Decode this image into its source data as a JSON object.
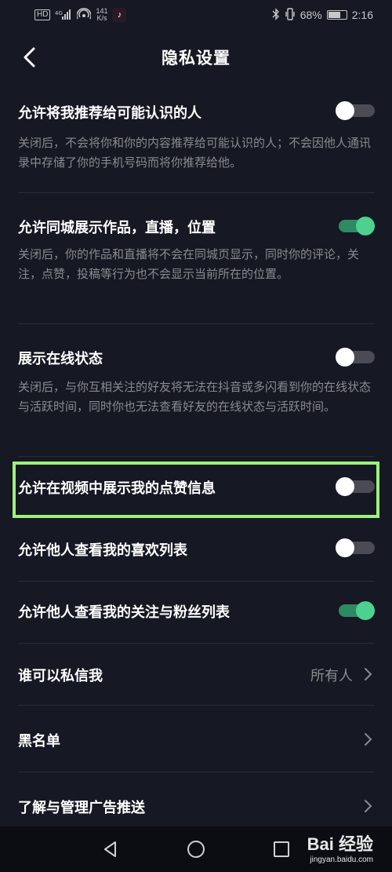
{
  "status_bar": {
    "hd": "HD",
    "network": "4G",
    "speed": "141",
    "speed_unit": "K/s",
    "tiktok_icon": "♪",
    "battery": "68%",
    "time": "2:16"
  },
  "header": {
    "title": "隐私设置"
  },
  "settings": [
    {
      "title": "允许将我推荐给可能认识的人",
      "description": "关闭后，不会将你和你的内容推荐给可能认识的人；不会因他人通讯录中存储了你的手机号码而将你推荐给他。",
      "enabled": false
    },
    {
      "title": "允许同城展示作品，直播，位置",
      "description": "关闭后，你的作品和直播将不会在同城页显示，同时你的评论，关注，点赞，投稿等行为也不会显示当前所在的位置。",
      "enabled": true
    },
    {
      "title": "展示在线状态",
      "description": "关闭后，与你互相关注的好友将无法在抖音或多闪看到你的在线状态与活跃时间，同时你也无法查看好友的在线状态与活跃时间。",
      "enabled": false
    },
    {
      "title": "允许在视频中展示我的点赞信息",
      "enabled": false
    },
    {
      "title": "允许他人查看我的喜欢列表",
      "enabled": false
    },
    {
      "title": "允许他人查看我的关注与粉丝列表",
      "enabled": true
    }
  ],
  "links": [
    {
      "title": "谁可以私信我",
      "value": "所有人"
    },
    {
      "title": "黑名单",
      "value": ""
    },
    {
      "title": "了解与管理广告推送",
      "value": ""
    }
  ],
  "watermark": {
    "logo": "Bai 经验",
    "url": "jingyan.baidu.com"
  },
  "colors": {
    "background": "#161823",
    "toggle_on": "#4ed18f",
    "toggle_off": "#4a4b55",
    "highlight": "#9ef07c",
    "secondary_text": "#8a8b91"
  }
}
